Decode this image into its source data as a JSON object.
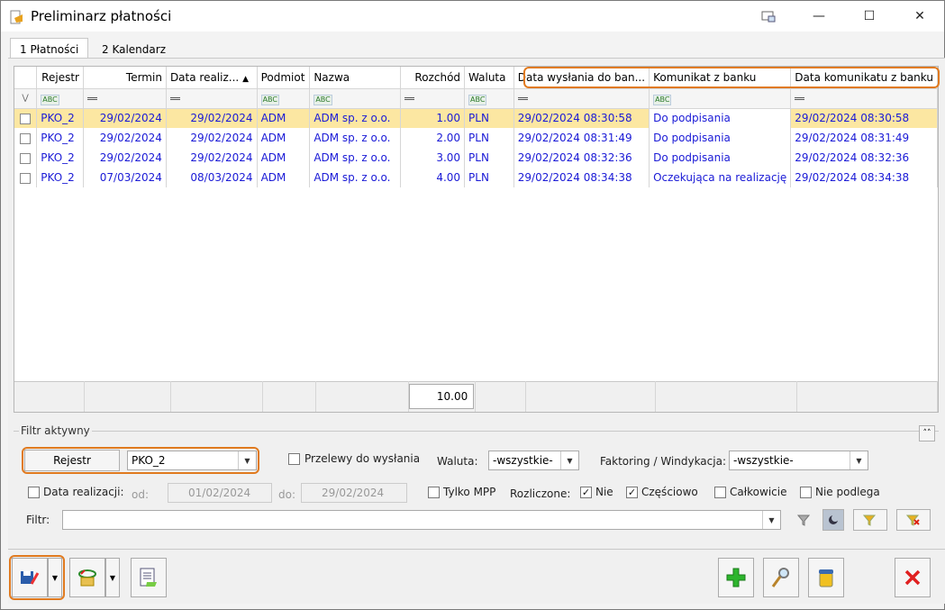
{
  "window": {
    "title": "Preliminarz płatności"
  },
  "tabs": [
    {
      "label": "1 Płatności"
    },
    {
      "label": "2 Kalendarz"
    }
  ],
  "grid": {
    "headers": [
      "Rejestr",
      "Termin",
      "Data realiz...",
      "Podmiot",
      "Nazwa",
      "Rozchód",
      "Waluta",
      "Data wysłania do ban...",
      "Komunikat z banku",
      "Data komunikatu z banku"
    ],
    "rows": [
      {
        "rejestr": "PKO_2",
        "termin": "29/02/2024",
        "data_realizacji": "29/02/2024",
        "podmiot": "ADM",
        "nazwa": "ADM sp. z o.o.",
        "rozchod": "1.00",
        "waluta": "PLN",
        "data_wyslania": "29/02/2024 08:30:58",
        "komunikat": "Do podpisania",
        "data_komunikatu": "29/02/2024 08:30:58"
      },
      {
        "rejestr": "PKO_2",
        "termin": "29/02/2024",
        "data_realizacji": "29/02/2024",
        "podmiot": "ADM",
        "nazwa": "ADM sp. z o.o.",
        "rozchod": "2.00",
        "waluta": "PLN",
        "data_wyslania": "29/02/2024 08:31:49",
        "komunikat": "Do podpisania",
        "data_komunikatu": "29/02/2024 08:31:49"
      },
      {
        "rejestr": "PKO_2",
        "termin": "29/02/2024",
        "data_realizacji": "29/02/2024",
        "podmiot": "ADM",
        "nazwa": "ADM sp. z o.o.",
        "rozchod": "3.00",
        "waluta": "PLN",
        "data_wyslania": "29/02/2024 08:32:36",
        "komunikat": "Do podpisania",
        "data_komunikatu": "29/02/2024 08:32:36"
      },
      {
        "rejestr": "PKO_2",
        "termin": "07/03/2024",
        "data_realizacji": "08/03/2024",
        "podmiot": "ADM",
        "nazwa": "ADM sp. z o.o.",
        "rozchod": "4.00",
        "waluta": "PLN",
        "data_wyslania": "29/02/2024 08:34:38",
        "komunikat": "Oczekująca na realizację",
        "data_komunikatu": "29/02/2024 08:34:38"
      }
    ],
    "sum_rozchod": "10.00",
    "filter_icon_abc": "ABC"
  },
  "filter": {
    "legend": "Filtr aktywny",
    "rejestr_label": "Rejestr",
    "rejestr_value": "PKO_2",
    "przelewy_label": "Przelewy do wysłania",
    "waluta_label": "Waluta:",
    "waluta_value": "-wszystkie-",
    "faktoring_label": "Faktoring / Windykacja:",
    "faktoring_value": "-wszystkie-",
    "data_realizacji_label": "Data realizacji:",
    "od_label": "od:",
    "od_value": "01/02/2024",
    "do_label": "do:",
    "do_value": "29/02/2024",
    "tylko_mpp_label": "Tylko MPP",
    "rozliczone_label": "Rozliczone:",
    "nie_label": "Nie",
    "czesciowo_label": "Częściowo",
    "calkowicie_label": "Całkowicie",
    "nie_podlega_label": "Nie podlega",
    "filtr_label": "Filtr:",
    "filtr_value": ""
  },
  "colors": {
    "accent_highlight": "#e07a1f",
    "selected_row": "#fce7a2",
    "link_text": "#1a1ad6"
  }
}
